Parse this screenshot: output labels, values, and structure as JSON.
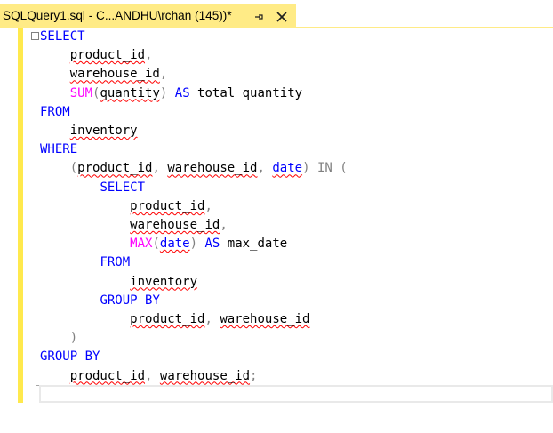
{
  "tab": {
    "title": "SQLQuery1.sql - C...ANDHU\\rchan (145))*",
    "pin_icon": "pin-icon",
    "close_icon": "close-icon"
  },
  "colors": {
    "tab_background": "#ffeb86",
    "change_bar": "#ffe94d",
    "keyword": "#0000ff",
    "function": "#ff00ff",
    "operator": "#808080",
    "identifier": "#000000",
    "squiggle": "#ff0000"
  },
  "code": {
    "lines": [
      [
        {
          "t": "SELECT",
          "c": "kw"
        }
      ],
      [
        {
          "t": "    "
        },
        {
          "t": "product_id",
          "c": "sq"
        },
        {
          "t": ",",
          "c": "gr"
        }
      ],
      [
        {
          "t": "    "
        },
        {
          "t": "warehouse_id",
          "c": "sq"
        },
        {
          "t": ",",
          "c": "gr"
        }
      ],
      [
        {
          "t": "    "
        },
        {
          "t": "SUM",
          "c": "fn"
        },
        {
          "t": "(",
          "c": "gr"
        },
        {
          "t": "quantity",
          "c": "sq"
        },
        {
          "t": ")",
          "c": "gr"
        },
        {
          "t": " "
        },
        {
          "t": "AS",
          "c": "kw"
        },
        {
          "t": " total_quantity"
        }
      ],
      [
        {
          "t": "FROM",
          "c": "kw"
        }
      ],
      [
        {
          "t": "    "
        },
        {
          "t": "inventory",
          "c": "sq"
        }
      ],
      [
        {
          "t": "WHERE",
          "c": "kw"
        }
      ],
      [
        {
          "t": "    "
        },
        {
          "t": "(",
          "c": "gr"
        },
        {
          "t": "product_id",
          "c": "sq"
        },
        {
          "t": ",",
          "c": "gr"
        },
        {
          "t": " "
        },
        {
          "t": "warehouse_id",
          "c": "sq"
        },
        {
          "t": ",",
          "c": "gr"
        },
        {
          "t": " "
        },
        {
          "t": "date",
          "c": "kw sq"
        },
        {
          "t": ")",
          "c": "gr"
        },
        {
          "t": " "
        },
        {
          "t": "IN",
          "c": "gr"
        },
        {
          "t": " "
        },
        {
          "t": "(",
          "c": "gr"
        }
      ],
      [
        {
          "t": "        "
        },
        {
          "t": "SELECT",
          "c": "kw"
        }
      ],
      [
        {
          "t": "            "
        },
        {
          "t": "product_id",
          "c": "sq"
        },
        {
          "t": ",",
          "c": "gr"
        }
      ],
      [
        {
          "t": "            "
        },
        {
          "t": "warehouse_id",
          "c": "sq"
        },
        {
          "t": ",",
          "c": "gr"
        }
      ],
      [
        {
          "t": "            "
        },
        {
          "t": "MAX",
          "c": "fn"
        },
        {
          "t": "(",
          "c": "gr"
        },
        {
          "t": "date",
          "c": "kw sq"
        },
        {
          "t": ")",
          "c": "gr"
        },
        {
          "t": " "
        },
        {
          "t": "AS",
          "c": "kw"
        },
        {
          "t": " max_date"
        }
      ],
      [
        {
          "t": "        "
        },
        {
          "t": "FROM",
          "c": "kw"
        }
      ],
      [
        {
          "t": "            "
        },
        {
          "t": "inventory",
          "c": "sq"
        }
      ],
      [
        {
          "t": "        "
        },
        {
          "t": "GROUP BY",
          "c": "kw"
        }
      ],
      [
        {
          "t": "            "
        },
        {
          "t": "product_id",
          "c": "sq"
        },
        {
          "t": ",",
          "c": "gr"
        },
        {
          "t": " "
        },
        {
          "t": "warehouse_id",
          "c": "sq"
        }
      ],
      [
        {
          "t": "    "
        },
        {
          "t": ")",
          "c": "gr"
        }
      ],
      [
        {
          "t": "GROUP BY",
          "c": "kw"
        }
      ],
      [
        {
          "t": "    "
        },
        {
          "t": "product_id",
          "c": "sq"
        },
        {
          "t": ",",
          "c": "gr"
        },
        {
          "t": " "
        },
        {
          "t": "warehouse_id",
          "c": "sq"
        },
        {
          "t": ";",
          "c": "gr"
        }
      ],
      [
        {
          "t": ""
        }
      ]
    ]
  }
}
